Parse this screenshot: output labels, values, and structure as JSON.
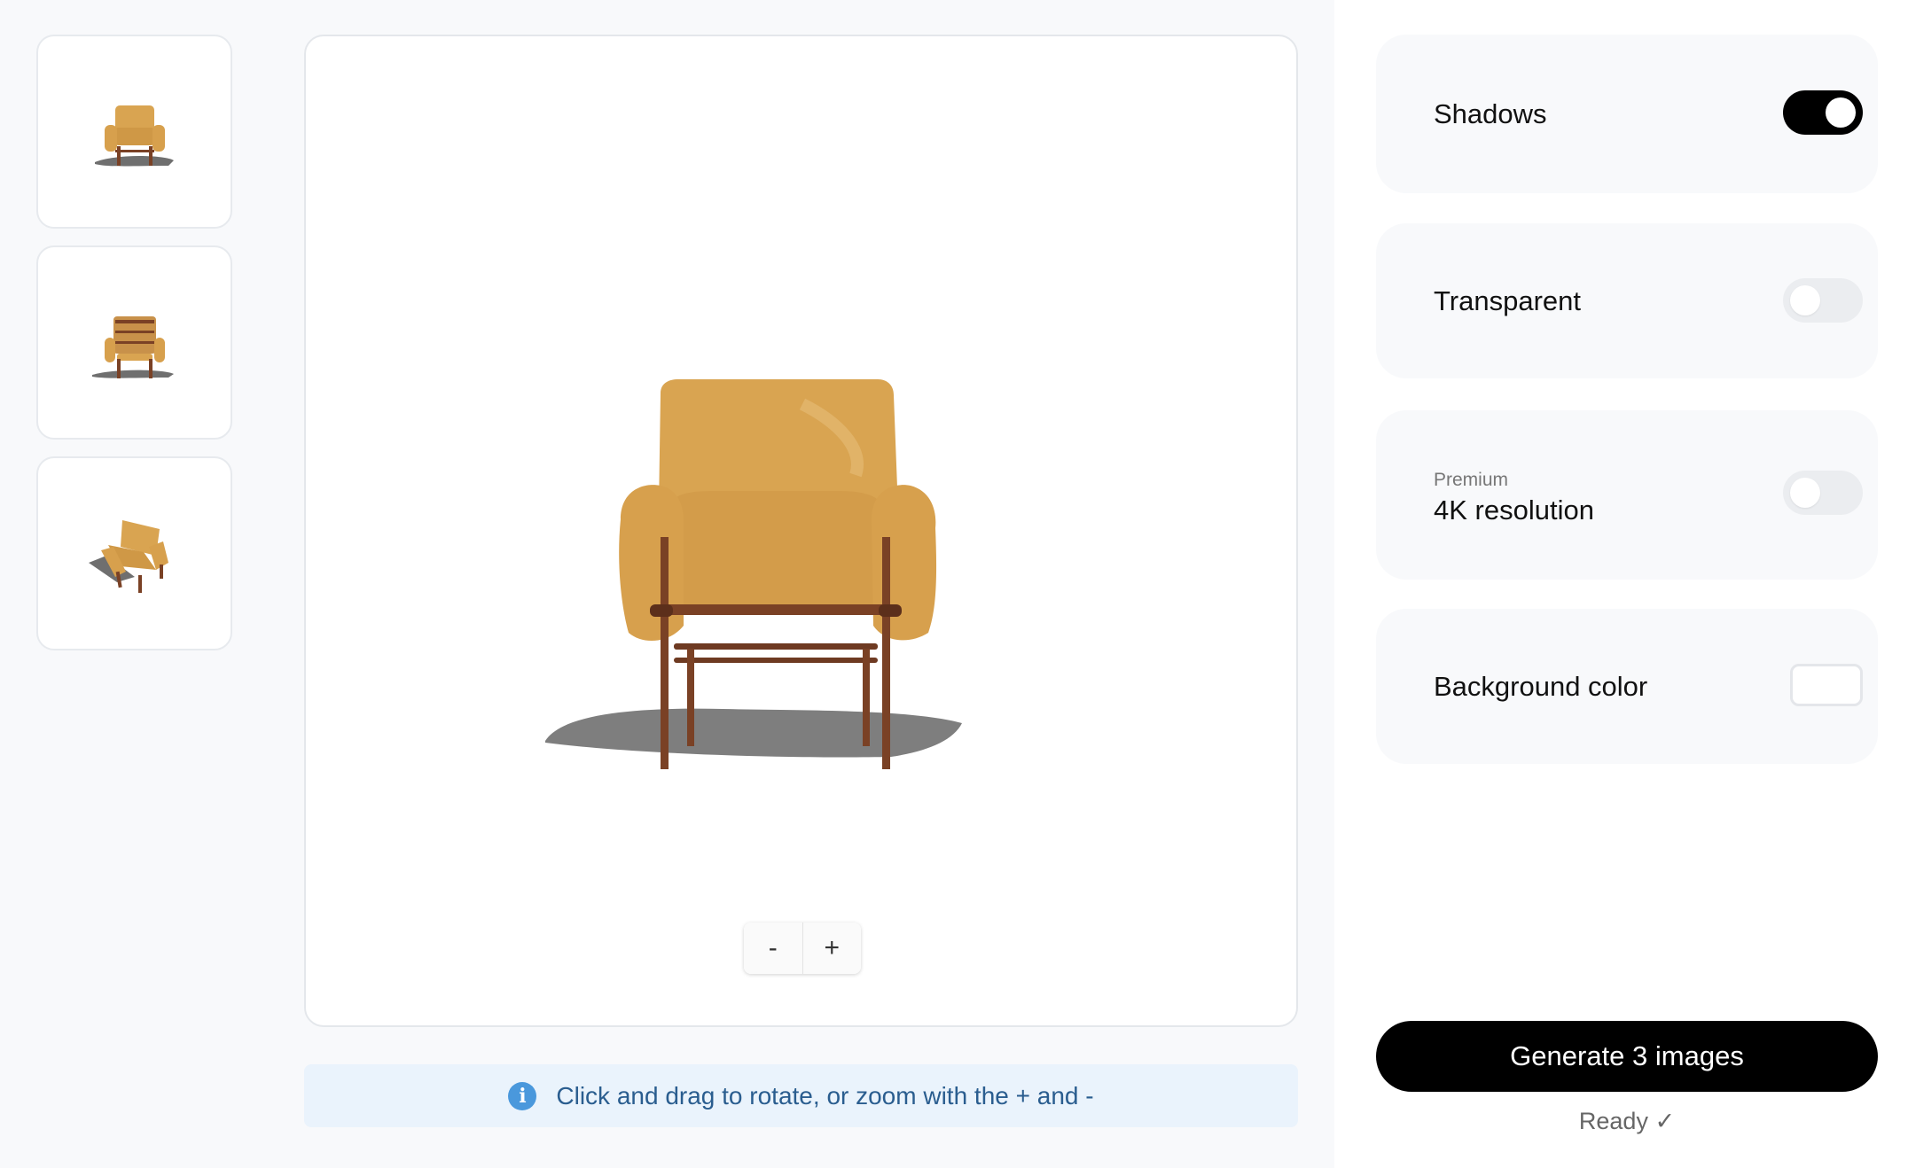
{
  "thumbnails": [
    {
      "name": "chair-front-view",
      "icon": "chair-front"
    },
    {
      "name": "chair-back-view",
      "icon": "chair-back"
    },
    {
      "name": "chair-angled-view",
      "icon": "chair-angled"
    }
  ],
  "viewer": {
    "zoom_out_label": "-",
    "zoom_in_label": "+"
  },
  "info": {
    "icon": "info-icon",
    "text": "Click and drag to rotate, or zoom with the + and -"
  },
  "options": {
    "shadows": {
      "label": "Shadows",
      "enabled": true
    },
    "transparent": {
      "label": "Transparent",
      "enabled": false
    },
    "resolution": {
      "sublabel": "Premium",
      "label": "4K resolution",
      "enabled": false
    },
    "background": {
      "label": "Background color",
      "color": "#ffffff"
    }
  },
  "actions": {
    "generate_label": "Generate 3 images",
    "status": "Ready ✓"
  },
  "colors": {
    "accent": "#000000",
    "leather": "#d9a451",
    "wood": "#7a4125",
    "info_bg": "#eaf3fc",
    "info_text": "#2a5d8f"
  }
}
